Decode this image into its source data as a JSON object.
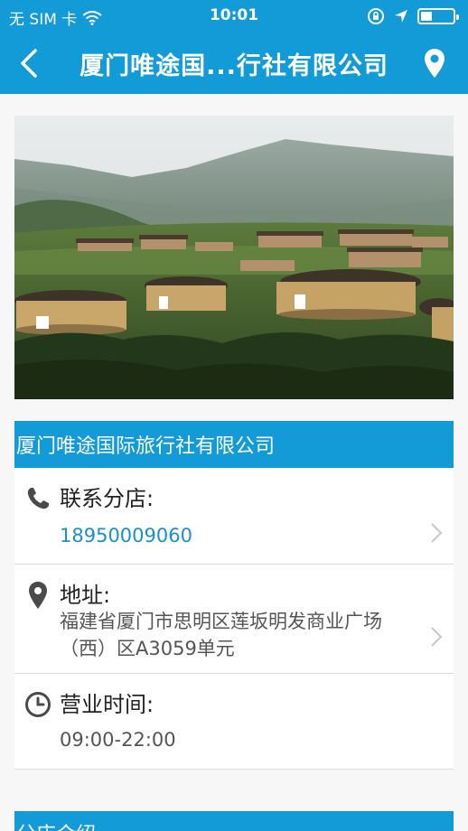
{
  "status_bar": {
    "carrier": "无 SIM 卡",
    "time": "10:01"
  },
  "nav": {
    "title": "厦门唯途国...行社有限公司"
  },
  "company": {
    "name": "厦门唯途国际旅行社有限公司"
  },
  "contact": {
    "label": "联系分店:",
    "phone": "18950009060"
  },
  "address": {
    "label": "地址:",
    "value": "福建省厦门市思明区莲坂明发商业广场（西）区A3059单元"
  },
  "hours": {
    "label": "营业时间:",
    "value": "09:00-22:00"
  },
  "intro": {
    "title": "分店介绍"
  },
  "colors": {
    "accent": "#129bd7",
    "link": "#1a8fd2"
  }
}
